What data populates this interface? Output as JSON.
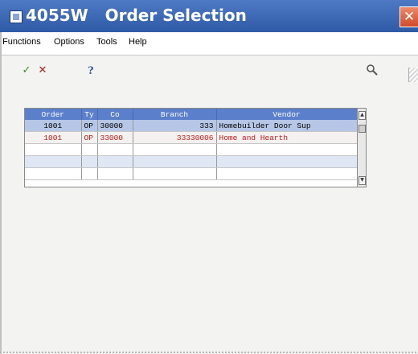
{
  "window": {
    "title": "4055W   Order Selection",
    "close_label": "✕"
  },
  "menubar": {
    "items": [
      "Functions",
      "Options",
      "Tools",
      "Help"
    ]
  },
  "toolbar": {
    "ok_icon": "✓",
    "cancel_icon": "✕",
    "help_icon": "?",
    "search_icon": "search-icon"
  },
  "grid": {
    "columns": [
      "Order",
      "Ty",
      "Co",
      "Branch",
      "Vendor"
    ],
    "rows": [
      {
        "order": "1001",
        "ty": "OP",
        "co": "30000",
        "branch": "333",
        "vendor": "Homebuilder Door Sup"
      },
      {
        "order": "1001",
        "ty": "OP",
        "co": "33000",
        "branch": "33330006",
        "vendor": "Home and Hearth"
      }
    ]
  },
  "colors": {
    "titlebar": "#3f6bbf",
    "grid_header": "#5b7fcb",
    "selected_row": "#b6c6e6",
    "red_text": "#c01818"
  }
}
